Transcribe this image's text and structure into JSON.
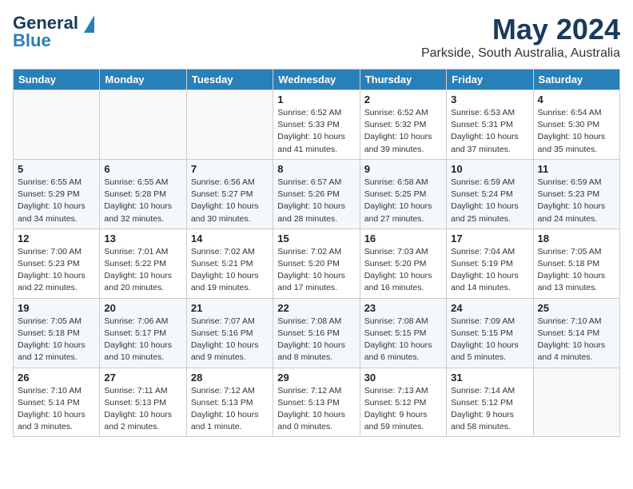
{
  "header": {
    "logo_line1": "General",
    "logo_line2": "Blue",
    "title": "May 2024",
    "subtitle": "Parkside, South Australia, Australia"
  },
  "weekdays": [
    "Sunday",
    "Monday",
    "Tuesday",
    "Wednesday",
    "Thursday",
    "Friday",
    "Saturday"
  ],
  "weeks": [
    [
      {
        "day": "",
        "info": ""
      },
      {
        "day": "",
        "info": ""
      },
      {
        "day": "",
        "info": ""
      },
      {
        "day": "1",
        "info": "Sunrise: 6:52 AM\nSunset: 5:33 PM\nDaylight: 10 hours\nand 41 minutes."
      },
      {
        "day": "2",
        "info": "Sunrise: 6:52 AM\nSunset: 5:32 PM\nDaylight: 10 hours\nand 39 minutes."
      },
      {
        "day": "3",
        "info": "Sunrise: 6:53 AM\nSunset: 5:31 PM\nDaylight: 10 hours\nand 37 minutes."
      },
      {
        "day": "4",
        "info": "Sunrise: 6:54 AM\nSunset: 5:30 PM\nDaylight: 10 hours\nand 35 minutes."
      }
    ],
    [
      {
        "day": "5",
        "info": "Sunrise: 6:55 AM\nSunset: 5:29 PM\nDaylight: 10 hours\nand 34 minutes."
      },
      {
        "day": "6",
        "info": "Sunrise: 6:55 AM\nSunset: 5:28 PM\nDaylight: 10 hours\nand 32 minutes."
      },
      {
        "day": "7",
        "info": "Sunrise: 6:56 AM\nSunset: 5:27 PM\nDaylight: 10 hours\nand 30 minutes."
      },
      {
        "day": "8",
        "info": "Sunrise: 6:57 AM\nSunset: 5:26 PM\nDaylight: 10 hours\nand 28 minutes."
      },
      {
        "day": "9",
        "info": "Sunrise: 6:58 AM\nSunset: 5:25 PM\nDaylight: 10 hours\nand 27 minutes."
      },
      {
        "day": "10",
        "info": "Sunrise: 6:59 AM\nSunset: 5:24 PM\nDaylight: 10 hours\nand 25 minutes."
      },
      {
        "day": "11",
        "info": "Sunrise: 6:59 AM\nSunset: 5:23 PM\nDaylight: 10 hours\nand 24 minutes."
      }
    ],
    [
      {
        "day": "12",
        "info": "Sunrise: 7:00 AM\nSunset: 5:23 PM\nDaylight: 10 hours\nand 22 minutes."
      },
      {
        "day": "13",
        "info": "Sunrise: 7:01 AM\nSunset: 5:22 PM\nDaylight: 10 hours\nand 20 minutes."
      },
      {
        "day": "14",
        "info": "Sunrise: 7:02 AM\nSunset: 5:21 PM\nDaylight: 10 hours\nand 19 minutes."
      },
      {
        "day": "15",
        "info": "Sunrise: 7:02 AM\nSunset: 5:20 PM\nDaylight: 10 hours\nand 17 minutes."
      },
      {
        "day": "16",
        "info": "Sunrise: 7:03 AM\nSunset: 5:20 PM\nDaylight: 10 hours\nand 16 minutes."
      },
      {
        "day": "17",
        "info": "Sunrise: 7:04 AM\nSunset: 5:19 PM\nDaylight: 10 hours\nand 14 minutes."
      },
      {
        "day": "18",
        "info": "Sunrise: 7:05 AM\nSunset: 5:18 PM\nDaylight: 10 hours\nand 13 minutes."
      }
    ],
    [
      {
        "day": "19",
        "info": "Sunrise: 7:05 AM\nSunset: 5:18 PM\nDaylight: 10 hours\nand 12 minutes."
      },
      {
        "day": "20",
        "info": "Sunrise: 7:06 AM\nSunset: 5:17 PM\nDaylight: 10 hours\nand 10 minutes."
      },
      {
        "day": "21",
        "info": "Sunrise: 7:07 AM\nSunset: 5:16 PM\nDaylight: 10 hours\nand 9 minutes."
      },
      {
        "day": "22",
        "info": "Sunrise: 7:08 AM\nSunset: 5:16 PM\nDaylight: 10 hours\nand 8 minutes."
      },
      {
        "day": "23",
        "info": "Sunrise: 7:08 AM\nSunset: 5:15 PM\nDaylight: 10 hours\nand 6 minutes."
      },
      {
        "day": "24",
        "info": "Sunrise: 7:09 AM\nSunset: 5:15 PM\nDaylight: 10 hours\nand 5 minutes."
      },
      {
        "day": "25",
        "info": "Sunrise: 7:10 AM\nSunset: 5:14 PM\nDaylight: 10 hours\nand 4 minutes."
      }
    ],
    [
      {
        "day": "26",
        "info": "Sunrise: 7:10 AM\nSunset: 5:14 PM\nDaylight: 10 hours\nand 3 minutes."
      },
      {
        "day": "27",
        "info": "Sunrise: 7:11 AM\nSunset: 5:13 PM\nDaylight: 10 hours\nand 2 minutes."
      },
      {
        "day": "28",
        "info": "Sunrise: 7:12 AM\nSunset: 5:13 PM\nDaylight: 10 hours\nand 1 minute."
      },
      {
        "day": "29",
        "info": "Sunrise: 7:12 AM\nSunset: 5:13 PM\nDaylight: 10 hours\nand 0 minutes."
      },
      {
        "day": "30",
        "info": "Sunrise: 7:13 AM\nSunset: 5:12 PM\nDaylight: 9 hours\nand 59 minutes."
      },
      {
        "day": "31",
        "info": "Sunrise: 7:14 AM\nSunset: 5:12 PM\nDaylight: 9 hours\nand 58 minutes."
      },
      {
        "day": "",
        "info": ""
      }
    ]
  ]
}
